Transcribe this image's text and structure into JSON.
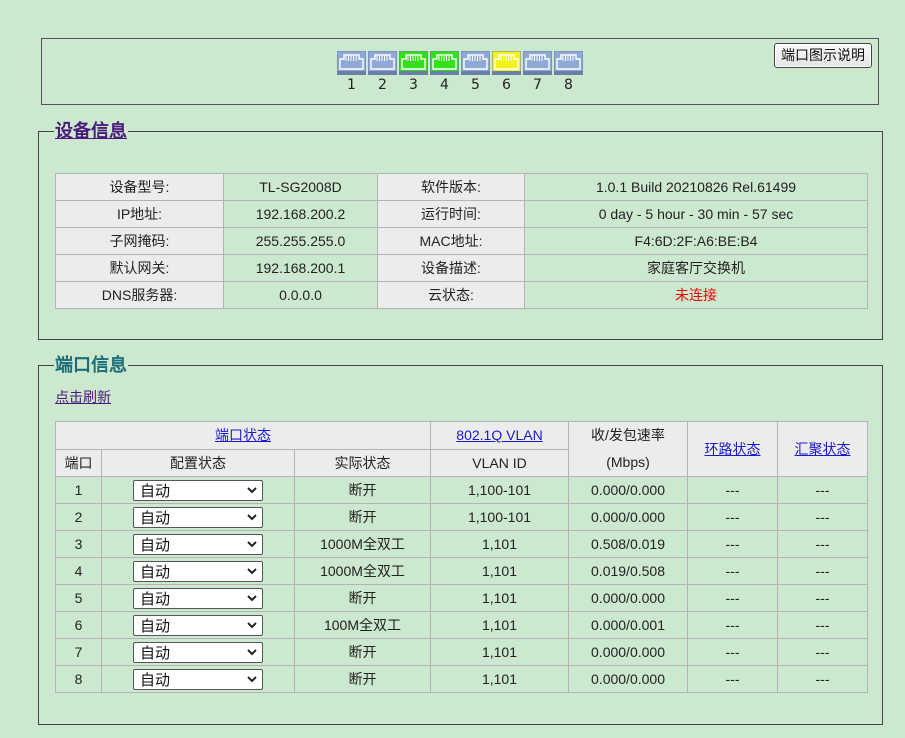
{
  "port_panel": {
    "legend_button": "端口图示说明",
    "ports": [
      {
        "num": "1",
        "state": "down"
      },
      {
        "num": "2",
        "state": "down"
      },
      {
        "num": "3",
        "state": "1000M"
      },
      {
        "num": "4",
        "state": "1000M"
      },
      {
        "num": "5",
        "state": "down"
      },
      {
        "num": "6",
        "state": "100M"
      },
      {
        "num": "7",
        "state": "down"
      },
      {
        "num": "8",
        "state": "down"
      }
    ],
    "colors": {
      "down": "#8fa9d6",
      "1000M": "#33e01a",
      "100M": "#f2f21a"
    }
  },
  "device_info": {
    "title": "设备信息",
    "rows": [
      {
        "l1": "设备型号:",
        "v1": "TL-SG2008D",
        "l2": "软件版本:",
        "v2": "1.0.1 Build 20210826 Rel.61499"
      },
      {
        "l1": "IP地址:",
        "v1": "192.168.200.2",
        "l2": "运行时间:",
        "v2": "0 day - 5 hour - 30 min - 57 sec"
      },
      {
        "l1": "子网掩码:",
        "v1": "255.255.255.0",
        "l2": "MAC地址:",
        "v2": "F4:6D:2F:A6:BE:B4"
      },
      {
        "l1": "默认网关:",
        "v1": "192.168.200.1",
        "l2": "设备描述:",
        "v2": "家庭客厅交换机"
      },
      {
        "l1": "DNS服务器:",
        "v1": "0.0.0.0",
        "l2": "云状态:",
        "v2": "未连接"
      }
    ]
  },
  "port_info": {
    "title": "端口信息",
    "refresh": "点击刷新",
    "headers": {
      "port_status": "端口状态",
      "vlan": "802.1Q VLAN",
      "rate_line1": "收/发包速率",
      "rate_line2": "(Mbps)",
      "loop": "环路状态",
      "agg": "汇聚状态",
      "port": "端口",
      "config": "配置状态",
      "actual": "实际状态",
      "vlan_id": "VLAN ID"
    },
    "rows": [
      {
        "port": "1",
        "config": "自动",
        "actual": "断开",
        "vlan": "1,100-101",
        "rate": "0.000/0.000",
        "loop": "---",
        "agg": "---"
      },
      {
        "port": "2",
        "config": "自动",
        "actual": "断开",
        "vlan": "1,100-101",
        "rate": "0.000/0.000",
        "loop": "---",
        "agg": "---"
      },
      {
        "port": "3",
        "config": "自动",
        "actual": "1000M全双工",
        "vlan": "1,101",
        "rate": "0.508/0.019",
        "loop": "---",
        "agg": "---"
      },
      {
        "port": "4",
        "config": "自动",
        "actual": "1000M全双工",
        "vlan": "1,101",
        "rate": "0.019/0.508",
        "loop": "---",
        "agg": "---"
      },
      {
        "port": "5",
        "config": "自动",
        "actual": "断开",
        "vlan": "1,101",
        "rate": "0.000/0.000",
        "loop": "---",
        "agg": "---"
      },
      {
        "port": "6",
        "config": "自动",
        "actual": "100M全双工",
        "vlan": "1,101",
        "rate": "0.000/0.001",
        "loop": "---",
        "agg": "---"
      },
      {
        "port": "7",
        "config": "自动",
        "actual": "断开",
        "vlan": "1,101",
        "rate": "0.000/0.000",
        "loop": "---",
        "agg": "---"
      },
      {
        "port": "8",
        "config": "自动",
        "actual": "断开",
        "vlan": "1,101",
        "rate": "0.000/0.000",
        "loop": "---",
        "agg": "---"
      }
    ]
  }
}
